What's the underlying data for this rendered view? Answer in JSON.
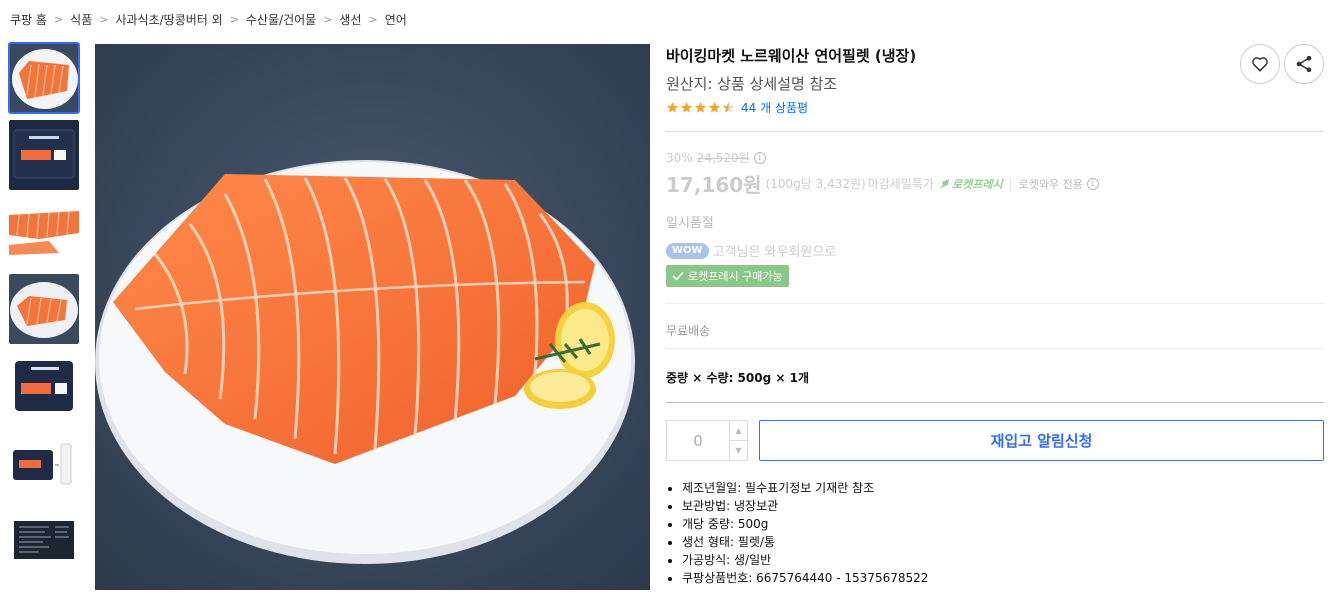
{
  "breadcrumb": [
    "쿠팡 홈",
    "식품",
    "사과식초/땅콩버터 외",
    "수산물/건어물",
    "생선",
    "연어"
  ],
  "product": {
    "title": "바이킹마켓 노르웨이산 연어필렛 (냉장)",
    "origin": "원산지: 상품 상세설명 참조",
    "rating": 4.5,
    "review_count_text": "44 개 상품평"
  },
  "price": {
    "discount": "30%",
    "original_price": "24,520원",
    "sale_price": "17,160원",
    "unit_price": "(100g당 3,432원)",
    "deal_label": "마감세일특가",
    "rocket_fresh_label": "로켓프레시",
    "wow_only_label": "로켓와우 전용",
    "info_glyph": "i",
    "status": "일시품절"
  },
  "wow": {
    "badge": "WOW",
    "text": "고객님은 와우회원으로"
  },
  "fresh_badge": "로켓프레시 구매가능",
  "shipping": "무료배송",
  "option": {
    "label": "중량 × 수량: 500g × 1개"
  },
  "quantity": {
    "value": "0",
    "up_glyph": "▲",
    "down_glyph": "▼"
  },
  "restock_button": "재입고 알림신청",
  "details": [
    "제조년월일: 필수표기정보 기재란 참조",
    "보관방법: 냉장보관",
    "개당 중량: 500g",
    "생선 형태: 필렛/통",
    "가공방식: 생/일반",
    "쿠팡상품번호: 6675764440 - 15375678522"
  ],
  "icons": {
    "heart": "heart-icon",
    "share": "share-icon",
    "check": "check-icon",
    "rocket": "rocket-icon",
    "chevron": "chevron-right-icon"
  },
  "colors": {
    "accent": "#346aff",
    "link": "#0073e9",
    "star": "#f5a623",
    "fresh_green": "#8ac88a",
    "wow_badge": "#a9c2f0"
  }
}
